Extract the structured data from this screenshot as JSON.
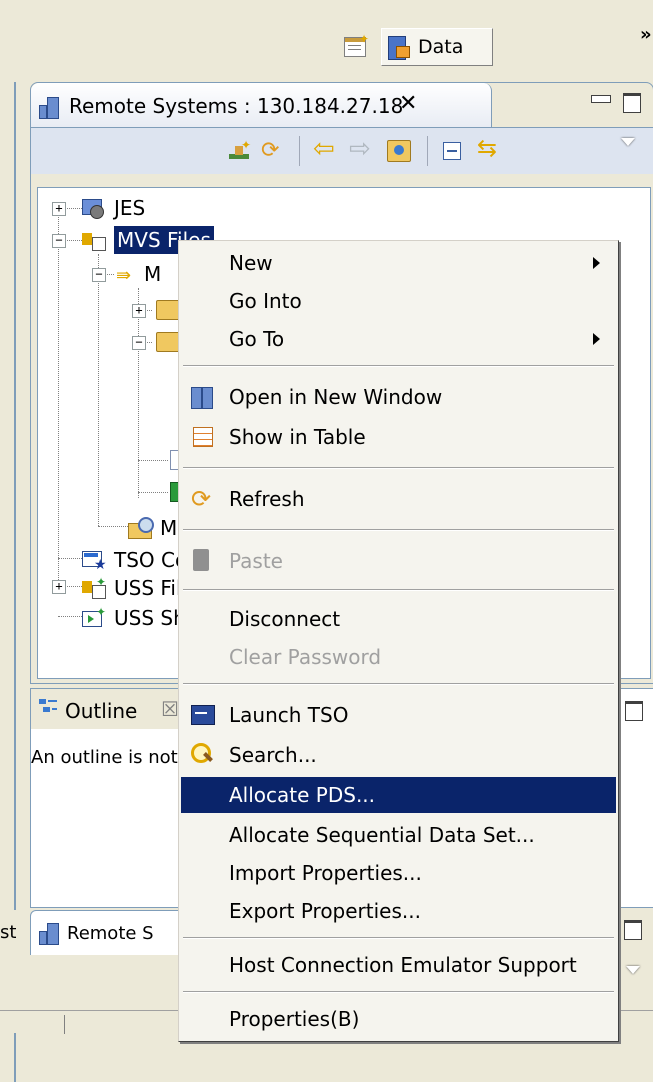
{
  "perspective_bar": {
    "data_label": "Data",
    "more": "»"
  },
  "remote_view": {
    "tab_title": "Remote Systems : 130.184.27.18",
    "close": "✕"
  },
  "tree": {
    "items": [
      {
        "label": "JES"
      },
      {
        "label": "MVS Files"
      },
      {
        "label": "M"
      },
      {
        "label": "M"
      },
      {
        "label": "TSO Commands"
      },
      {
        "label": "USS Files"
      },
      {
        "label": "USS Shells"
      }
    ]
  },
  "outline_view": {
    "tab_title": "Outline",
    "tab_close": "☒",
    "message": "An outline is not available."
  },
  "bottom_tabs": {
    "left_partial": "st",
    "remote_tab": "Remote S"
  },
  "context_menu": {
    "new": "New",
    "go_into": "Go Into",
    "go_to": "Go To",
    "open_in_new_window": "Open in New Window",
    "show_in_table": "Show in Table",
    "refresh": "Refresh",
    "paste": "Paste",
    "disconnect": "Disconnect",
    "clear_password": "Clear Password",
    "launch_tso": "Launch TSO",
    "search": "Search...",
    "allocate_pds": "Allocate PDS...",
    "allocate_sequential": "Allocate Sequential Data Set...",
    "import_properties": "Import Properties...",
    "export_properties": "Export Properties...",
    "host_connection": "Host Connection Emulator Support",
    "properties": "Properties(B)"
  },
  "colors": {
    "selection": "#0a246a",
    "view_border": "#7f9db9",
    "background": "#ece9d8"
  }
}
